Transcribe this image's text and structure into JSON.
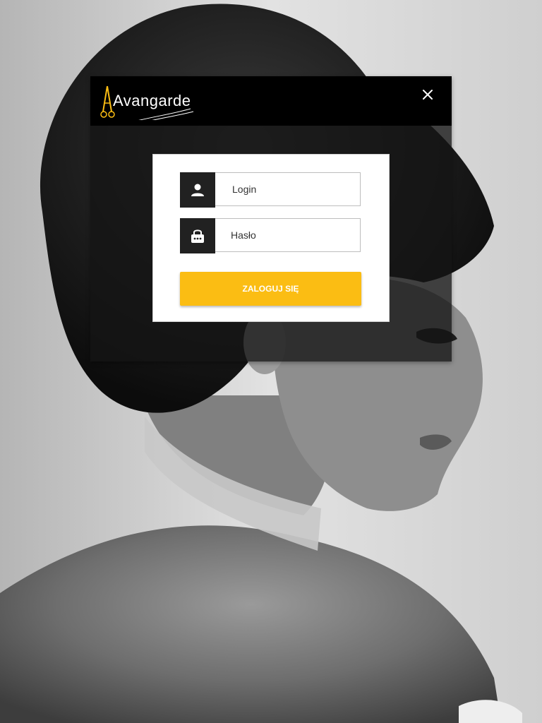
{
  "app": {
    "logo_text": "Avangarde",
    "logo_icon": "scissors-icon"
  },
  "modal": {
    "close_icon": "close-icon"
  },
  "login_form": {
    "login_placeholder": "Login",
    "login_icon": "user-icon",
    "password_placeholder": "Hasło",
    "password_icon": "lock-icon",
    "submit_label": "ZALOGUJ SIĘ"
  },
  "colors": {
    "accent": "#fbbd13",
    "header": "#000000",
    "icon_box": "#212121"
  }
}
